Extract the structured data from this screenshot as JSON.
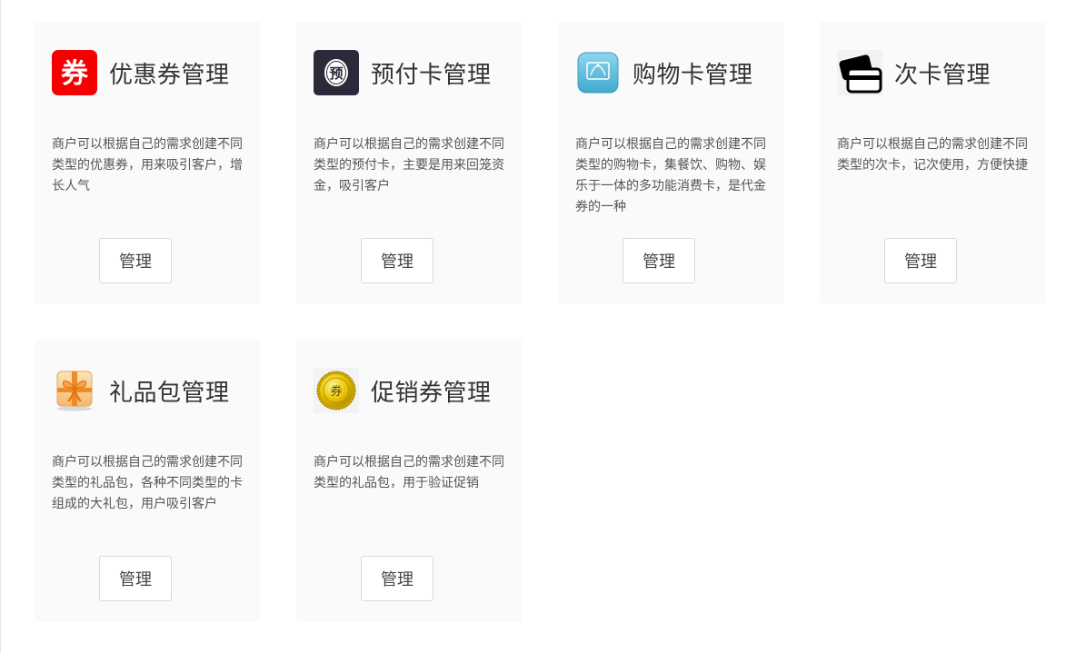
{
  "cards": [
    {
      "title": "优惠券管理",
      "description": "商户可以根据自己的需求创建不同类型的优惠券，用来吸引客户，增长人气",
      "button": "管理",
      "icon": "coupon-icon",
      "icon_text": "券"
    },
    {
      "title": "预付卡管理",
      "description": "商户可以根据自己的需求创建不同类型的预付卡，主要是用来回笼资金，吸引客户",
      "button": "管理",
      "icon": "prepaid-card-icon",
      "icon_text": "预"
    },
    {
      "title": "购物卡管理",
      "description": "商户可以根据自己的需求创建不同类型的购物卡，集餐饮、购物、娱乐于一体的多功能消费卡，是代金券的一种",
      "button": "管理",
      "icon": "shopping-card-icon"
    },
    {
      "title": "次卡管理",
      "description": "商户可以根据自己的需求创建不同类型的次卡，记次使用，方便快捷",
      "button": "管理",
      "icon": "count-card-icon"
    },
    {
      "title": "礼品包管理",
      "description": "商户可以根据自己的需求创建不同类型的礼品包，各种不同类型的卡组成的大礼包，用户吸引客户",
      "button": "管理",
      "icon": "gift-package-icon"
    },
    {
      "title": "促销券管理",
      "description": "商户可以根据自己的需求创建不同类型的礼品包，用于验证促销",
      "button": "管理",
      "icon": "promo-coupon-icon",
      "icon_text": "券"
    }
  ],
  "colors": {
    "card_bg": "#fafafa",
    "coupon_red": "#f40000",
    "prepaid_dark": "#2b2a3a",
    "shopping_blue": "#55b8d8",
    "gift_orange": "#f08a24",
    "promo_gold": "#e8c400"
  }
}
